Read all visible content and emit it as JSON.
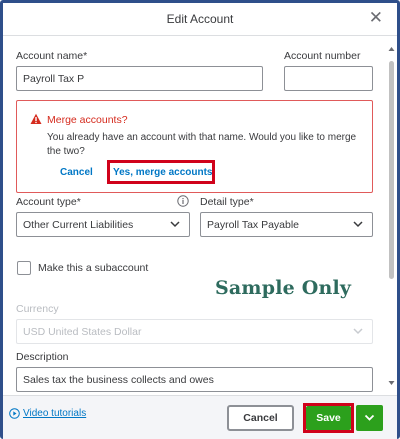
{
  "dialog": {
    "title": "Edit Account",
    "close_glyph": "✕"
  },
  "form": {
    "account_name_label": "Account name*",
    "account_name_value": "Payroll Tax P",
    "account_number_label": "Account number",
    "account_number_value": "",
    "account_type_label": "Account type*",
    "account_type_value": "Other Current Liabilities",
    "detail_type_label": "Detail type*",
    "detail_type_value": "Payroll Tax Payable",
    "subaccount_label": "Make this a subaccount",
    "subaccount_checked": false,
    "currency_label": "Currency",
    "currency_value": "USD United States Dollar",
    "description_label": "Description",
    "description_value": "Sales tax the business collects and owes"
  },
  "alert": {
    "title": "Merge accounts?",
    "message": "You already have an account with that name. Would you like to merge the two?",
    "cancel_label": "Cancel",
    "merge_label": "Yes, merge accounts",
    "color": "#d52b1e"
  },
  "watermark": "Sample Only",
  "footer": {
    "video_label": "Video tutorials",
    "cancel_label": "Cancel",
    "save_label": "Save"
  },
  "colors": {
    "accent_link": "#0077c5",
    "save_green": "#2ca01c",
    "highlight_red": "#d0021b",
    "frame_blue": "#2f4f8a"
  }
}
